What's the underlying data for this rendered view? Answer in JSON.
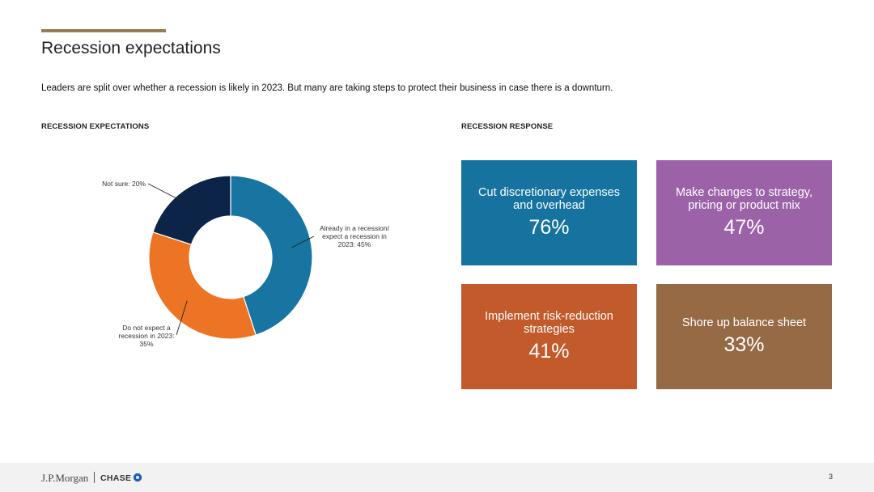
{
  "title": "Recession expectations",
  "intro": "Leaders are split over whether a recession is likely in 2023. But many are taking steps to protect their business in case there is a downturn.",
  "sections": {
    "left": "RECESSION EXPECTATIONS",
    "right": "RECESSION RESPONSE"
  },
  "chart_data": [
    {
      "type": "pie",
      "subtype": "donut",
      "title": "",
      "slices": [
        {
          "label_lines": [
            "Already in a recession/",
            "expect a recession in",
            "2023: 45%"
          ],
          "value": 45,
          "color": "#1874a0"
        },
        {
          "label_lines": [
            "Do not expect a",
            "recession in 2023:",
            "35%"
          ],
          "value": 35,
          "color": "#ec7424"
        },
        {
          "label_lines": [
            "Not sure: 20%"
          ],
          "value": 20,
          "color": "#0c2447"
        }
      ]
    },
    {
      "type": "table",
      "subtype": "stat-tiles",
      "title": "",
      "tiles": [
        {
          "label": "Cut discretionary expenses and overhead",
          "value": "76%",
          "color": "#1673a0"
        },
        {
          "label": "Make changes to strategy, pricing or product mix",
          "value": "47%",
          "color": "#9b62a8"
        },
        {
          "label": "Implement risk-reduction strategies",
          "value": "41%",
          "color": "#c25a2b"
        },
        {
          "label": "Shore up balance sheet",
          "value": "33%",
          "color": "#956a45"
        }
      ]
    }
  ],
  "footer": {
    "brand_left": "J.P.Morgan",
    "brand_right": "CHASE",
    "page_number": "3"
  },
  "icons": {
    "chase": "chase-octagon-icon"
  }
}
